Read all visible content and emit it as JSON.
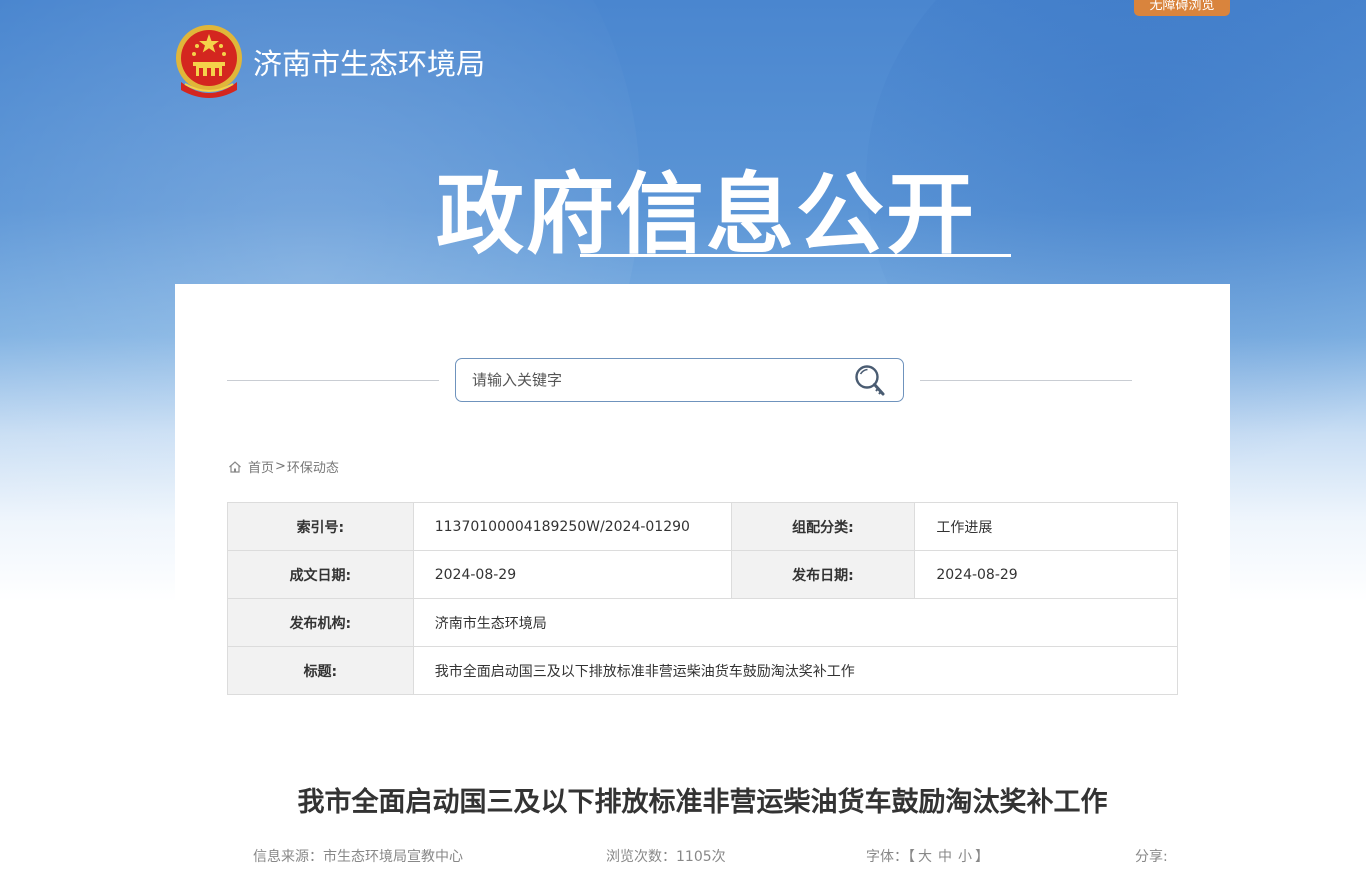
{
  "header": {
    "accessibility_label": "无障碍浏览",
    "site_title": "济南市生态环境局",
    "section_title": "政府信息公开",
    "brand_colors": {
      "primary_blue": "#4a86cf",
      "accent_orange": "#d9843d"
    }
  },
  "search": {
    "placeholder": "请输入关键字",
    "icon": "search-key-icon"
  },
  "breadcrumb": {
    "home": "首页",
    "separator": ">",
    "current": "环保动态"
  },
  "meta_table": {
    "rows": [
      {
        "label1": "索引号:",
        "value1": "11370100004189250W/2024-01290",
        "label2": "组配分类:",
        "value2": "工作进展"
      },
      {
        "label1": "成文日期:",
        "value1": "2024-08-29",
        "label2": "发布日期:",
        "value2": "2024-08-29"
      },
      {
        "label1": "发布机构:",
        "value1": "济南市生态环境局"
      },
      {
        "label1": "标题:",
        "value1": "我市全面启动国三及以下排放标准非营运柴油货车鼓励淘汰奖补工作"
      }
    ]
  },
  "article": {
    "title": "我市全面启动国三及以下排放标准非营运柴油货车鼓励淘汰奖补工作",
    "source_label": "信息来源：",
    "source_value": "市生态环境局宣教中心",
    "views_label": "浏览次数：",
    "views_value": "1105次",
    "font_label": "字体：",
    "font_open": "【",
    "font_large": "大",
    "font_medium": "中",
    "font_small": "小",
    "font_close": "】",
    "share_label": "分享:"
  }
}
